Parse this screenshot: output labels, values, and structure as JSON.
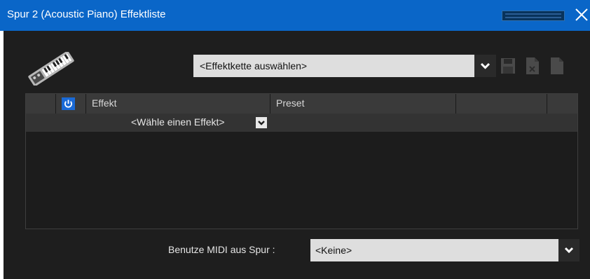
{
  "window": {
    "title": "Spur 2 (Acoustic Piano) Effektliste",
    "titlebar_color": "#0a66c8",
    "background": "#1e1e1e"
  },
  "titlebar": {
    "meter_icon": "level-meter-icon",
    "close_icon": "close-icon"
  },
  "toolbar": {
    "instrument_icon": "keyboard-instrument-icon",
    "chain_select": {
      "value": "<Effektkette auswählen>",
      "icon": "chevron-down-icon"
    },
    "buttons": [
      {
        "name": "save-chain-button",
        "icon": "save-icon"
      },
      {
        "name": "delete-chain-button",
        "icon": "delete-document-icon"
      },
      {
        "name": "new-chain-button",
        "icon": "new-document-icon"
      }
    ]
  },
  "table": {
    "columns": [
      "",
      "",
      "Effekt",
      "Preset",
      "",
      ""
    ],
    "power_icon": "power-icon",
    "accent": "#1a6ad6",
    "rows": [
      {
        "effect_select": "<Wähle einen Effekt>"
      }
    ]
  },
  "midi": {
    "label": "Benutze MIDI aus Spur :",
    "value": "<Keine>"
  }
}
